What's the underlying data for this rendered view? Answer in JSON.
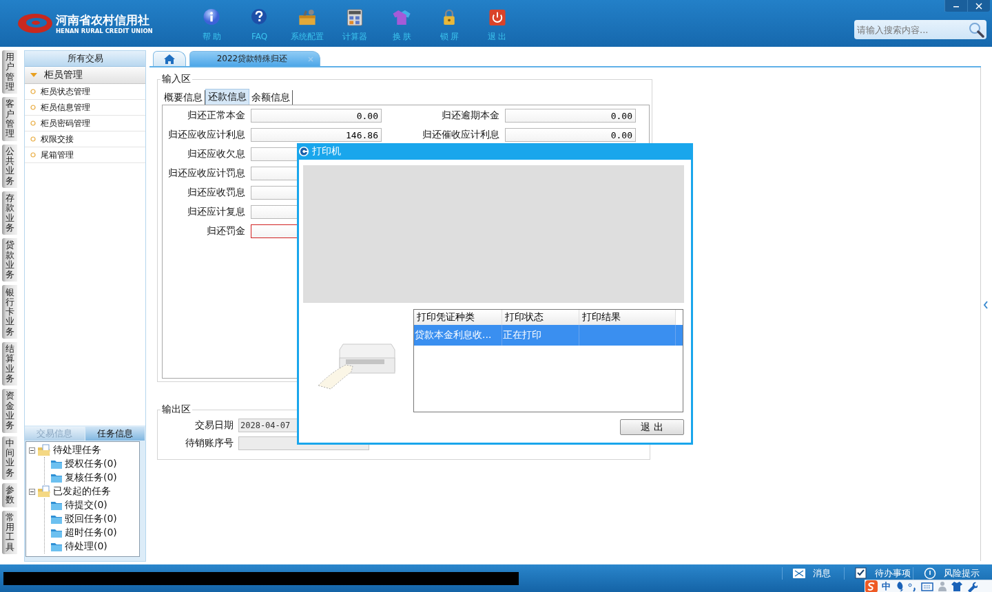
{
  "header": {
    "logo_title": "河南省农村信用社",
    "logo_subtitle": "HENAN RURAL CREDIT UNION",
    "tools": [
      {
        "label": "帮 助"
      },
      {
        "label": "FAQ"
      },
      {
        "label": "系统配置"
      },
      {
        "label": "计算器"
      },
      {
        "label": "换 肤"
      },
      {
        "label": "锁 屏"
      },
      {
        "label": "退 出"
      }
    ],
    "search": {
      "placeholder": "请输入搜索内容..."
    }
  },
  "side_tabs": [
    "用户管理",
    "客户管理",
    "公共业务",
    "存款业务",
    "贷款业务",
    "银行卡业务",
    "结算业务",
    "资金业务",
    "中间业务",
    "参数",
    "常用工具"
  ],
  "nav": {
    "title": "所有交易",
    "group": {
      "label": "柜员管理",
      "expanded": true
    },
    "items": [
      "柜员状态管理",
      "柜员信息管理",
      "柜员密码管理",
      "权限交接",
      "尾箱管理"
    ]
  },
  "task_panel": {
    "tabs": [
      {
        "label": "交易信息",
        "selected": false
      },
      {
        "label": "任务信息",
        "selected": true
      }
    ],
    "tree": [
      {
        "label": "待处理任务",
        "expanded": true,
        "children": [
          {
            "label": "授权任务(0)"
          },
          {
            "label": "复核任务(0)"
          }
        ]
      },
      {
        "label": "已发起的任务",
        "expanded": true,
        "children": [
          {
            "label": "待提交(0)"
          },
          {
            "label": "驳回任务(0)"
          },
          {
            "label": "超时任务(0)"
          },
          {
            "label": "待处理(0)"
          }
        ]
      }
    ]
  },
  "doc_tabs": [
    {
      "kind": "home",
      "selected": false
    },
    {
      "kind": "page",
      "label": "2022贷款特殊归还",
      "selected": true
    }
  ],
  "input_area": {
    "title": "输入区",
    "tabs": [
      {
        "label": "概要信息",
        "selected": false
      },
      {
        "label": "还款信息",
        "selected": true
      },
      {
        "label": "余额信息",
        "selected": false
      }
    ],
    "fields_left": [
      {
        "label": "归还正常本金",
        "value": "0.00",
        "error": false
      },
      {
        "label": "归还应收应计利息",
        "value": "146.86",
        "error": false
      },
      {
        "label": "归还应收欠息",
        "error": false
      },
      {
        "label": "归还应收应计罚息",
        "error": false
      },
      {
        "label": "归还应收罚息",
        "error": false
      },
      {
        "label": "归还应计复息",
        "error": false
      },
      {
        "label": "归还罚金",
        "error": true
      }
    ],
    "fields_right": [
      {
        "label": "归还逾期本金",
        "value": "0.00"
      },
      {
        "label": "归还催收应计利息",
        "value": "0.00"
      }
    ]
  },
  "output_area": {
    "title": "输出区",
    "fields": [
      {
        "label": "交易日期",
        "value": "2028-04-07"
      },
      {
        "label": "待销账序号"
      }
    ]
  },
  "dialog": {
    "title": "打印机",
    "table": {
      "columns": [
        "打印凭证种类",
        "打印状态",
        "打印结果"
      ],
      "rows": [
        {
          "cells": [
            "贷款本金利息收...",
            "正在打印"
          ],
          "selected": true
        }
      ]
    },
    "button": "退 出"
  },
  "status_bar": {
    "items": [
      {
        "label": "消息"
      },
      {
        "label": "待办事项"
      },
      {
        "label": "风险提示"
      }
    ]
  },
  "ime_toolbar": {
    "mode": "中"
  }
}
